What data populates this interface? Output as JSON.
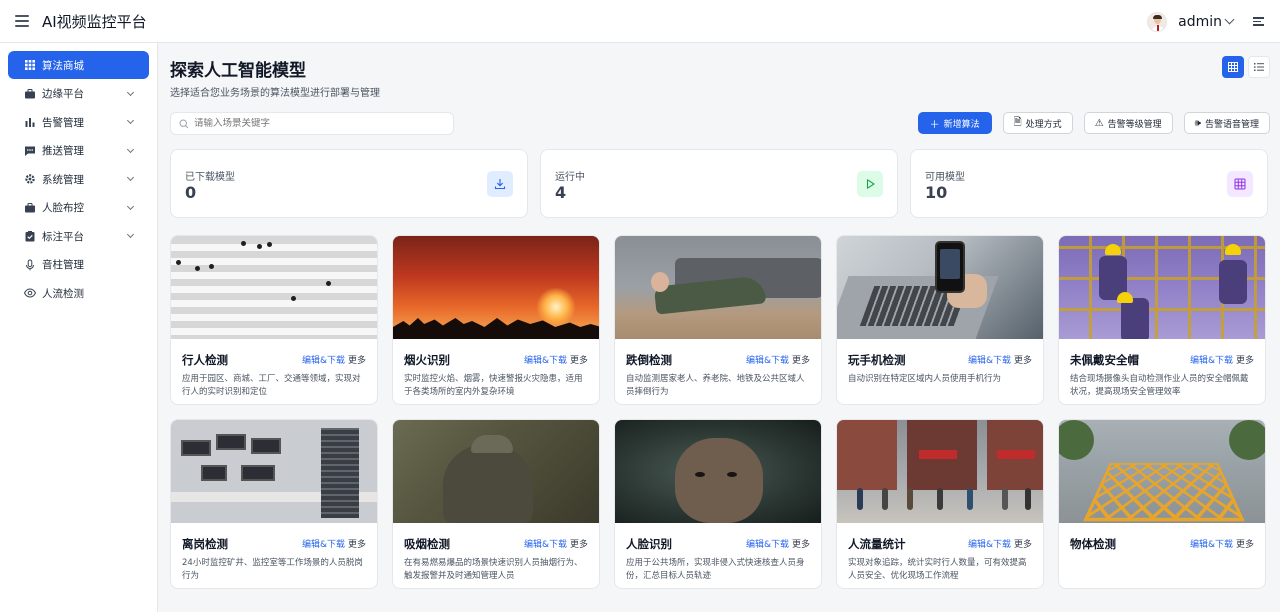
{
  "header": {
    "app_title": "AI视频监控平台",
    "user_name": "admin"
  },
  "sidebar": {
    "items": [
      {
        "label": "算法商城",
        "icon": "grid-icon",
        "active": true,
        "expandable": false
      },
      {
        "label": "边缘平台",
        "icon": "briefcase-icon",
        "active": false,
        "expandable": true
      },
      {
        "label": "告警管理",
        "icon": "bar-chart-icon",
        "active": false,
        "expandable": true
      },
      {
        "label": "推送管理",
        "icon": "message-icon",
        "active": false,
        "expandable": true
      },
      {
        "label": "系统管理",
        "icon": "gear-icon",
        "active": false,
        "expandable": true
      },
      {
        "label": "人脸布控",
        "icon": "briefcase-icon",
        "active": false,
        "expandable": true
      },
      {
        "label": "标注平台",
        "icon": "clipboard-check-icon",
        "active": false,
        "expandable": true
      },
      {
        "label": "音柱管理",
        "icon": "microphone-icon",
        "active": false,
        "expandable": false
      },
      {
        "label": "人流检测",
        "icon": "eye-icon",
        "active": false,
        "expandable": false
      }
    ]
  },
  "main": {
    "title": "探索人工智能模型",
    "subtitle": "选择适合您业务场景的算法模型进行部署与管理",
    "search_placeholder": "请输入场景关键字",
    "actions": {
      "add": "新增算法",
      "process": "处理方式",
      "alarm_level": "告警等级管理",
      "alarm_voice": "告警语音管理"
    },
    "stats": [
      {
        "label": "已下载模型",
        "value": "0",
        "icon": "download-icon",
        "color": "#2563eb",
        "bg": "#e0ecff"
      },
      {
        "label": "运行中",
        "value": "4",
        "icon": "play-icon",
        "color": "#16a34a",
        "bg": "#dcfce7"
      },
      {
        "label": "可用模型",
        "value": "10",
        "icon": "grid-icon",
        "color": "#9333ea",
        "bg": "#f3e8ff"
      }
    ],
    "card_edit_label": "编辑&下载",
    "card_more_label": "更多",
    "cards": [
      {
        "title": "行人检测",
        "desc": "应用于园区、商城、工厂、交通等领域，实现对行人的实时识别和定位"
      },
      {
        "title": "烟火识别",
        "desc": "实时监控火焰、烟雾，快速警报火灾隐患，适用于各类场所的室内外复杂环境"
      },
      {
        "title": "跌倒检测",
        "desc": "自动监测居家老人、养老院、地铁及公共区域人员摔倒行为"
      },
      {
        "title": "玩手机检测",
        "desc": "自动识别在特定区域内人员使用手机行为"
      },
      {
        "title": "未佩戴安全帽",
        "desc": "结合现场摄像头自动检测作业人员的安全帽佩戴状况，提高现场安全管理效率"
      },
      {
        "title": "离岗检测",
        "desc": "24小时监控矿井、监控室等工作场景的人员脱岗行为"
      },
      {
        "title": "吸烟检测",
        "desc": "在有易燃易爆品的场景快速识别人员抽烟行为、触发报警并及时通知管理人员"
      },
      {
        "title": "人脸识别",
        "desc": "应用于公共场所，实现非侵入式快速核查人员身份，汇总目标人员轨迹"
      },
      {
        "title": "人流量统计",
        "desc": "实现对象追踪，统计实时行人数量，可有效提高人员安全、优化现场工作流程"
      },
      {
        "title": "物体检测",
        "desc": ""
      }
    ]
  }
}
